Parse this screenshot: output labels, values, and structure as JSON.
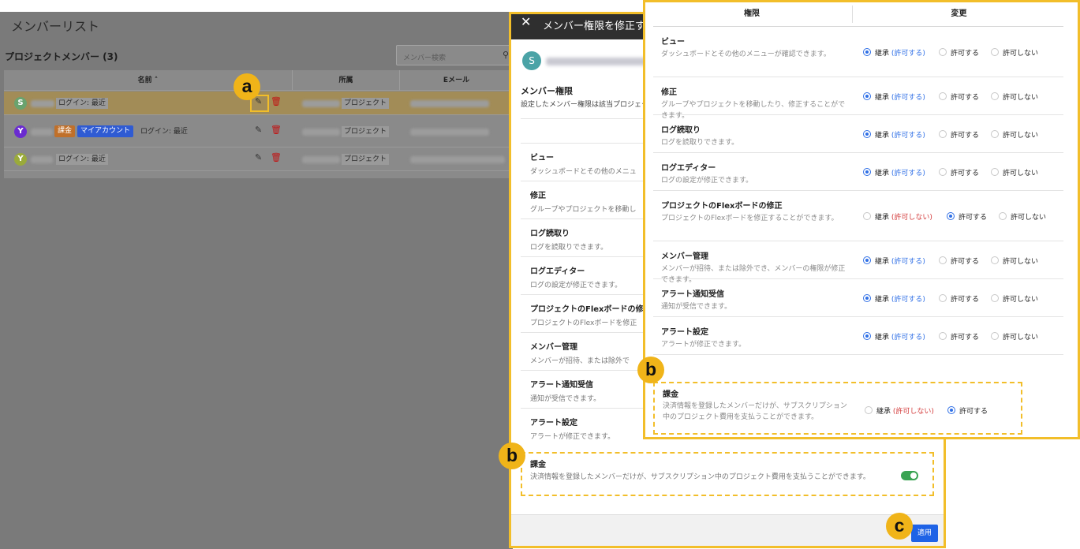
{
  "background": {
    "page_title": "メンバーリスト",
    "section_title": "プロジェクトメンバー (3)",
    "search_placeholder": "メンバー検索",
    "columns": [
      "名前 ˄",
      "所属",
      "Eメール"
    ],
    "rows": [
      {
        "avatar": "S",
        "avatar_color": "#6aa36e",
        "login": "ログイン: 最近",
        "affiliation": "プロジェクト",
        "selected": true
      },
      {
        "avatar": "Y",
        "avatar_color": "#6a2bd0",
        "badge_billing": "課金",
        "badge_myaccount": "マイアカウント",
        "login": "ログイン: 最近",
        "affiliation": "プロジェクト"
      },
      {
        "avatar": "Y",
        "avatar_color": "#9aaa3b",
        "login": "ログイン: 最近",
        "affiliation": "プロジェクト"
      }
    ]
  },
  "markers": {
    "a": "a",
    "b": "b",
    "c": "c"
  },
  "dialog": {
    "title": "メンバー権限を修正する",
    "avatar": "S",
    "perm_heading": "メンバー権限",
    "perm_desc": "設定したメンバー権限は該当プロジェクト",
    "items": [
      {
        "title": "ビュー",
        "desc": "ダッシュボードとその他のメニュ"
      },
      {
        "title": "修正",
        "desc": "グループやプロジェクトを移動し"
      },
      {
        "title": "ログ読取り",
        "desc": "ログを読取りできます。"
      },
      {
        "title": "ログエディター",
        "desc": "ログの設定が修正できます。"
      },
      {
        "title": "プロジェクトのFlexボードの修正",
        "desc": "プロジェクトのFlexボードを修正"
      },
      {
        "title": "メンバー管理",
        "desc": "メンバーが招待、または除外で"
      },
      {
        "title": "アラート通知受信",
        "desc": "通知が受信できます。"
      },
      {
        "title": "アラート設定",
        "desc": "アラートが修正できます。"
      }
    ],
    "billing": {
      "title": "課金",
      "desc": "決済情報を登録したメンバーだけが、サブスクリプション中のプロジェクト費用を支払うことができます。"
    },
    "apply": "適用"
  },
  "panel": {
    "header_perm": "権限",
    "header_change": "変更",
    "opt_inherit": "継承",
    "opt_allowed": "(許可する)",
    "opt_denied": "(許可しない)",
    "opt_allow": "許可する",
    "opt_deny": "許可しない",
    "rows": [
      {
        "title": "ビュー",
        "desc": "ダッシュボードとその他のメニューが確認できます。",
        "selected": "inherit"
      },
      {
        "title": "修正",
        "desc": "グループやプロジェクトを移動したり、修正することができます。",
        "selected": "inherit"
      },
      {
        "title": "ログ読取り",
        "desc": "ログを読取りできます。",
        "selected": "inherit"
      },
      {
        "title": "ログエディター",
        "desc": "ログの設定が修正できます。",
        "selected": "inherit"
      },
      {
        "title": "プロジェクトのFlexボードの修正",
        "desc": "プロジェクトのFlexボードを修正することができます。",
        "selected": "allow"
      },
      {
        "title": "メンバー管理",
        "desc": "メンバーが招待、または除外でき、メンバーの権限が修正できます。",
        "selected": "inherit"
      },
      {
        "title": "アラート通知受信",
        "desc": "通知が受信できます。",
        "selected": "inherit"
      },
      {
        "title": "アラート設定",
        "desc": "アラートが修正できます。",
        "selected": "inherit"
      }
    ],
    "billing": {
      "title": "課金",
      "desc": "決済情報を登録したメンバーだけが、サブスクリプション中のプロジェクト費用を支払うことができます。",
      "selected": "allow"
    }
  },
  "colors": {
    "highlight": "#f2be2a",
    "accent_blue": "#2f6fe6",
    "denied_red": "#d33b3b",
    "toggle_on": "#3aa353"
  }
}
